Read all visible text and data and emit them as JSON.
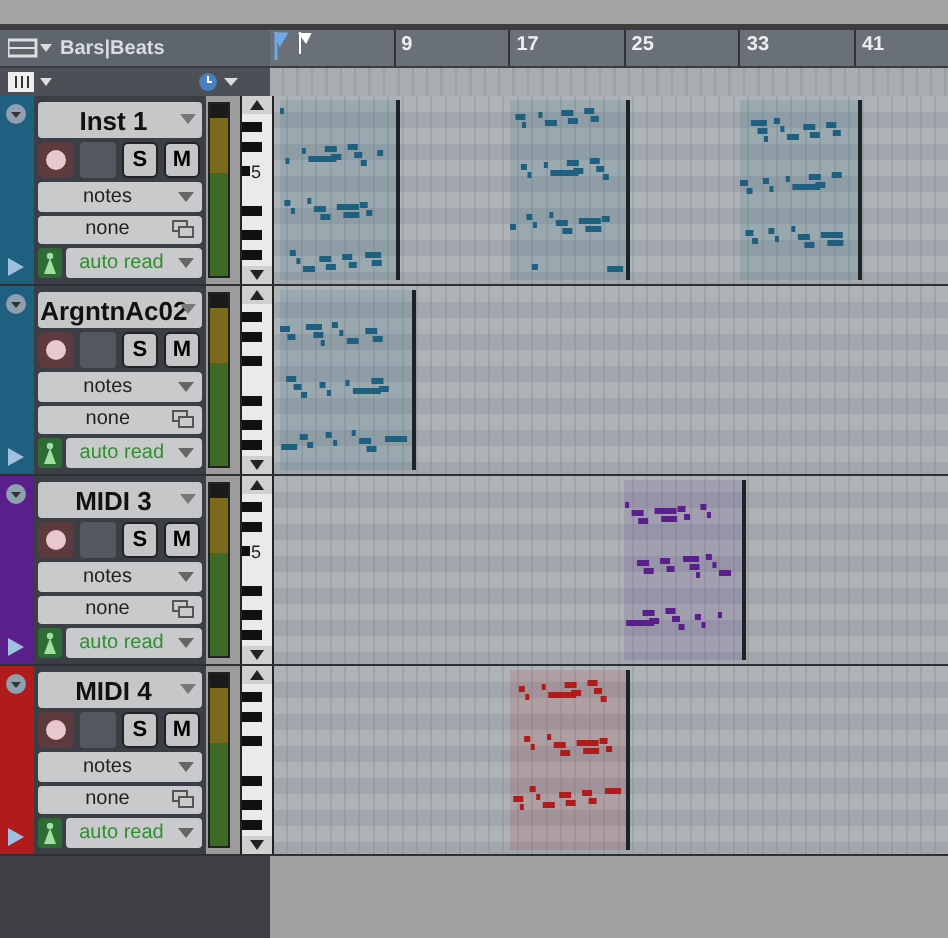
{
  "ruler": {
    "timebase": "Bars|Beats",
    "bars": [
      "9",
      "17",
      "25",
      "33",
      "41"
    ]
  },
  "tracks": [
    {
      "name": "Inst 1",
      "color": "#1f5f80",
      "record": false,
      "solo": false,
      "mute": false,
      "solo_label": "S",
      "mute_label": "M",
      "view": "notes",
      "automation": "none",
      "mode": "auto read",
      "key_label": "5"
    },
    {
      "name": "ArgntnAc02",
      "color": "#1f5f80",
      "record": false,
      "solo": false,
      "mute": false,
      "solo_label": "S",
      "mute_label": "M",
      "view": "notes",
      "automation": "none",
      "mode": "auto read"
    },
    {
      "name": "MIDI 3",
      "color": "#5b1f8c",
      "record": false,
      "solo": false,
      "mute": false,
      "solo_label": "S",
      "mute_label": "M",
      "view": "notes",
      "automation": "none",
      "mode": "auto read",
      "key_label": "5"
    },
    {
      "name": "MIDI 4",
      "color": "#b01c1c",
      "record": false,
      "solo": false,
      "mute": false,
      "solo_label": "S",
      "mute_label": "M",
      "view": "notes",
      "automation": "none",
      "mode": "auto read"
    }
  ]
}
